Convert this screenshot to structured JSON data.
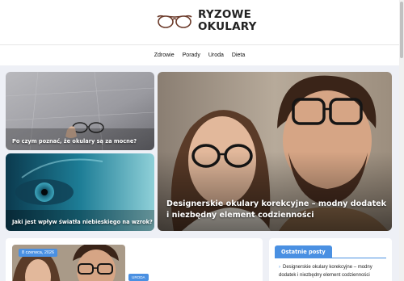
{
  "site": {
    "logo_line1": "RYZOWE",
    "logo_line2": "OKULARY"
  },
  "nav": {
    "items": [
      "Zdrowie",
      "Porady",
      "Uroda",
      "Dieta"
    ]
  },
  "featured": [
    {
      "title": "Po czym poznać, że okulary są za mocne?"
    },
    {
      "title": "Jaki jest wpływ światła niebieskiego na wzrok?"
    },
    {
      "title_line1": "Designerskie okulary korekcyjne – modny dodatek",
      "title_line2": "i niezbędny element codzienności"
    }
  ],
  "latest_post": {
    "date": "8 czerwca, 2026",
    "category": "URODA"
  },
  "sidebar": {
    "heading": "Ostatnie posty",
    "items": [
      "Designerskie okulary korekcyjne – modny dodatek i niezbędny element codzienności"
    ],
    "arrow": "›"
  },
  "colors": {
    "accent": "#4a90e2",
    "background": "#eef0f6"
  }
}
